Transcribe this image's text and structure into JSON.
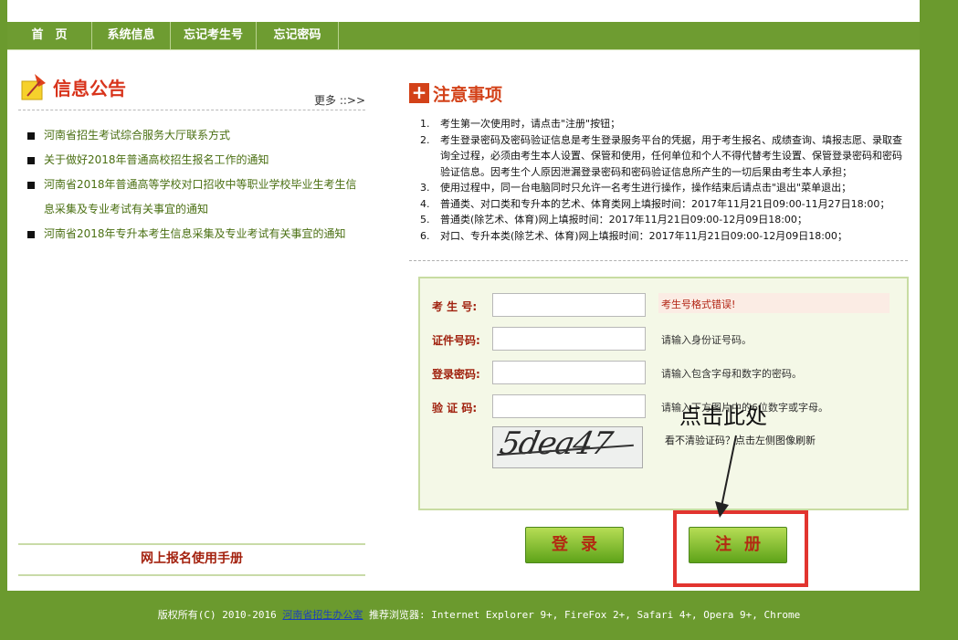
{
  "nav": {
    "items": [
      {
        "label": "首　页"
      },
      {
        "label": "系统信息"
      },
      {
        "label": "忘记考生号"
      },
      {
        "label": "忘记密码"
      }
    ]
  },
  "notice": {
    "title": "信息公告",
    "more": "更多 ::>>",
    "items": [
      "河南省招生考试综合服务大厅联系方式",
      "关于做好2018年普通高校招生报名工作的通知",
      "河南省2018年普通高等学校对口招收中等职业学校毕业生考生信息采集及专业考试有关事宜的通知",
      "河南省2018年专升本考生信息采集及专业考试有关事宜的通知"
    ]
  },
  "manual_link": "网上报名使用手册",
  "attention": {
    "title": "注意事项",
    "rules": [
      "考生第一次使用时，请点击\"注册\"按钮；",
      "考生登录密码及密码验证信息是考生登录服务平台的凭据，用于考生报名、成绩查询、填报志愿、录取查询全过程，必须由考生本人设置、保管和使用，任何单位和个人不得代替考生设置、保管登录密码和密码验证信息。因考生个人原因泄漏登录密码和密码验证信息所产生的一切后果由考生本人承担；",
      "使用过程中，同一台电脑同时只允许一名考生进行操作，操作结束后请点击\"退出\"菜单退出；",
      "普通类、对口类和专升本的艺术、体育类网上填报时间：2017年11月21日09:00-11月27日18:00；",
      "普通类(除艺术、体育)网上填报时间：2017年11月21日09:00-12月09日18:00；",
      "对口、专升本类(除艺术、体育)网上填报时间：2017年11月21日09:00-12月09日18:00；"
    ]
  },
  "form": {
    "exam_id": {
      "label": "考 生 号:",
      "value": "",
      "error": "考生号格式错误!"
    },
    "id_number": {
      "label": "证件号码:",
      "value": "",
      "hint": "请输入身份证号码。"
    },
    "password": {
      "label": "登录密码:",
      "value": "",
      "hint": "请输入包含字母和数字的密码。"
    },
    "captcha": {
      "label": "验 证 码:",
      "value": "",
      "hint": "请输入下方图片中的6位数字或字母。",
      "image_text": "5dea47",
      "refresh_hint": "看不清验证码？点击左侧图像刷新"
    }
  },
  "buttons": {
    "login": "登录",
    "register": "注册"
  },
  "annotation": "点击此处",
  "colors": {
    "brand_green": "#6b9a2e",
    "label_red": "#a0210e",
    "highlight": "#e2342f"
  },
  "footer": {
    "copyright": "版权所有(C) 2010-2016",
    "office": "河南省招生办公室",
    "browsers": "推荐浏览器: Internet Explorer 9+, FireFox 2+, Safari 4+, Opera 9+, Chrome"
  }
}
